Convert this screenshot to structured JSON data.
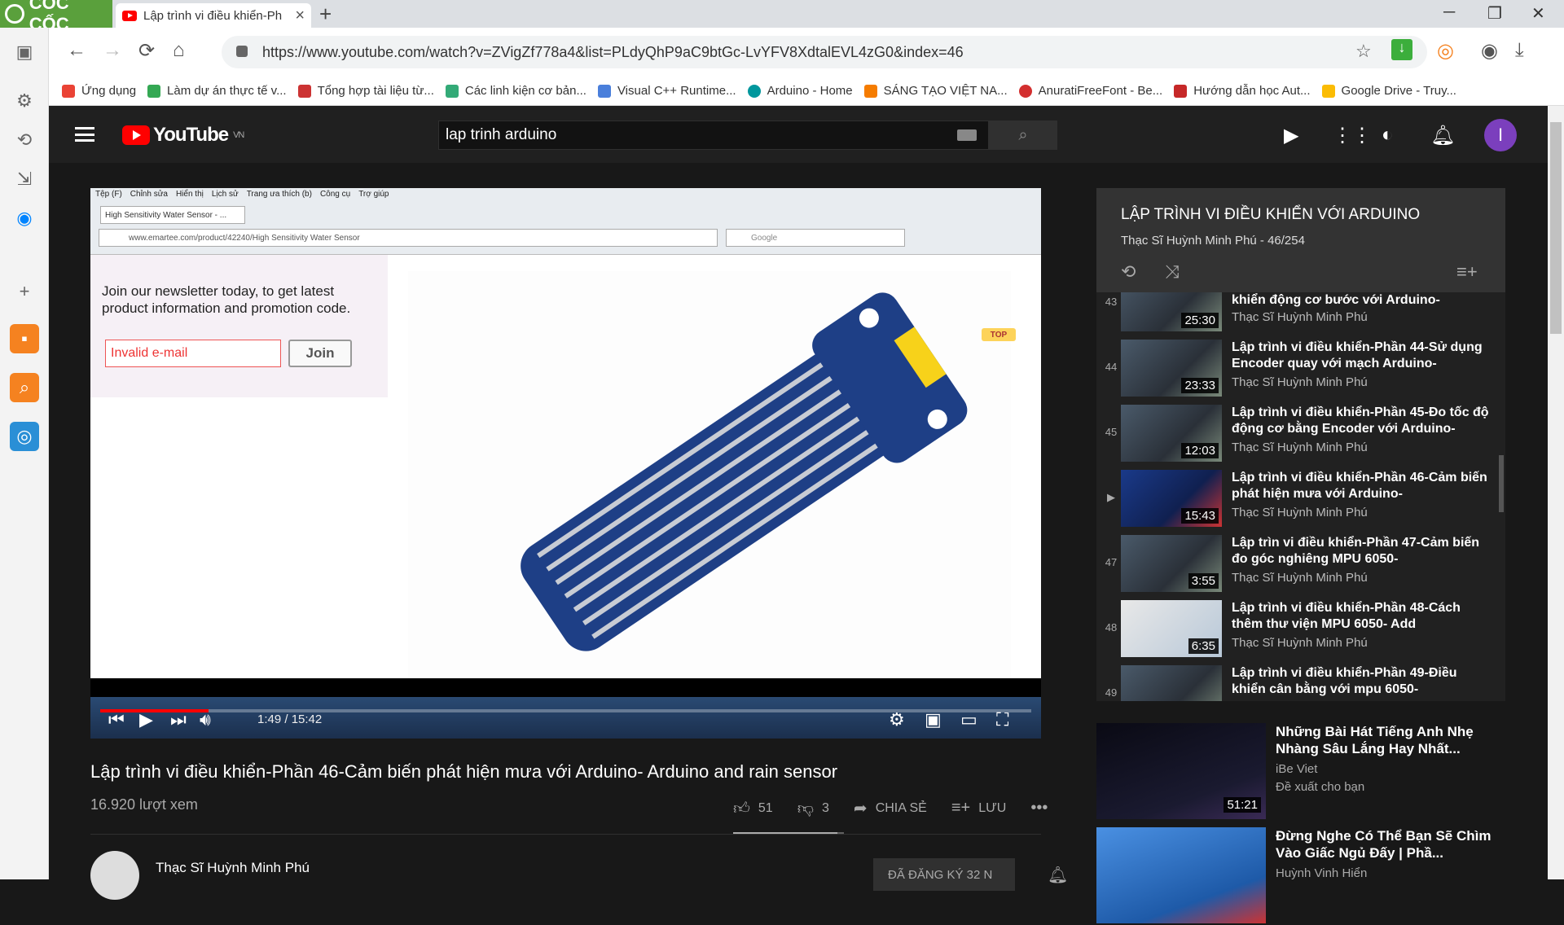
{
  "browser": {
    "brand": "CỐC CỐC",
    "tab_title": "Lập trình vi điều khiển-Ph",
    "url": "https://www.youtube.com/watch?v=ZVigZf778a4&list=PLdyQhP9aC9btGc-LvYFV8XdtalEVL4zG0&index=46",
    "bookmarks": [
      "Ứng dụng",
      "Làm dự án thực tế v...",
      "Tổng hợp tài liệu từ...",
      "Các linh kiện cơ bản...",
      "Visual C++ Runtime...",
      "Arduino - Home",
      "SÁNG TẠO VIỆT NA...",
      "AnuratiFreeFont - Be...",
      "Hướng dẫn học Aut...",
      "Google Drive - Truy..."
    ]
  },
  "youtube": {
    "logo": "YouTube",
    "region": "VN",
    "search_value": "lap trinh arduino",
    "avatar_letter": "I"
  },
  "player": {
    "ff_menu": [
      "Tệp (F)",
      "Chỉnh sửa",
      "Hiển thị",
      "Lịch sử",
      "Trang ưa thích (b)",
      "Công cụ",
      "Trợ giúp"
    ],
    "ff_tab": "High Sensitivity Water Sensor - ...",
    "ff_url": "www.emartee.com/product/42240/High Sensitivity Water Sensor",
    "ff_search": "Google",
    "newsletter_text": "Join our newsletter today, to get latest product information and promotion code.",
    "email_value": "Invalid e-mail",
    "join_label": "Join",
    "top_label": "TOP",
    "time": "1:49 / 15:42",
    "progress_fraction": 0.116
  },
  "video": {
    "title": "Lập trình vi điều khiển-Phần 46-Cảm biến phát hiện mưa với Arduino- Arduino and rain sensor",
    "views": "16.920 lượt xem",
    "likes": "51",
    "dislikes": "3",
    "share": "CHIA SẺ",
    "save": "LƯU",
    "like_ratio": 0.94,
    "channel": "Thạc Sĩ Huỳnh Minh Phú",
    "subscribe": "ĐÃ ĐĂNG KÝ 32 N"
  },
  "playlist": {
    "title": "LẬP TRÌNH VI ĐIỀU KHIỂN VỚI ARDUINO",
    "subtitle": "Thạc Sĩ Huỳnh Minh Phú - 46/254",
    "items": [
      {
        "idx": "43",
        "title": "khiển động cơ bước với Arduino-",
        "channel": "Thạc Sĩ Huỳnh Minh Phú",
        "duration": "25:30"
      },
      {
        "idx": "44",
        "title": "Lập trình vi điều khiển-Phần 44-Sử dụng Encoder quay với mạch Arduino-",
        "channel": "Thạc Sĩ Huỳnh Minh Phú",
        "duration": "23:33"
      },
      {
        "idx": "45",
        "title": "Lập trình vi điều khiển-Phần 45-Đo tốc độ động cơ bằng Encoder với Arduino-",
        "channel": "Thạc Sĩ Huỳnh Minh Phú",
        "duration": "12:03"
      },
      {
        "idx": "▶",
        "title": "Lập trình vi điều khiển-Phần 46-Cảm biến phát hiện mưa với Arduino-",
        "channel": "Thạc Sĩ Huỳnh Minh Phú",
        "duration": "15:43"
      },
      {
        "idx": "47",
        "title": "Lập trìn vi điều khiển-Phần 47-Cảm biến đo góc nghiêng MPU 6050-",
        "channel": "Thạc Sĩ Huỳnh Minh Phú",
        "duration": "3:55"
      },
      {
        "idx": "48",
        "title": "Lập trình vi điều khiển-Phần 48-Cách thêm thư viện MPU 6050- Add",
        "channel": "Thạc Sĩ Huỳnh Minh Phú",
        "duration": "6:35"
      },
      {
        "idx": "49",
        "title": "Lập trình vi điều khiển-Phần 49-Điều khiển cân bằng với mpu 6050-",
        "channel": "Thạc Sĩ Huỳnh Minh Phú",
        "duration": ""
      }
    ]
  },
  "recommended": [
    {
      "title": "Những Bài Hát Tiếng Anh Nhẹ Nhàng Sâu Lắng Hay Nhất...",
      "channel": "iBe Viet",
      "meta": "Đề xuất cho bạn",
      "duration": "51:21"
    },
    {
      "title": "Đừng Nghe Có Thể Bạn Sẽ Chìm Vào Giấc Ngủ Đấy | Phầ...",
      "channel": "Huỳnh Vinh Hiển",
      "meta": "",
      "duration": ""
    }
  ]
}
